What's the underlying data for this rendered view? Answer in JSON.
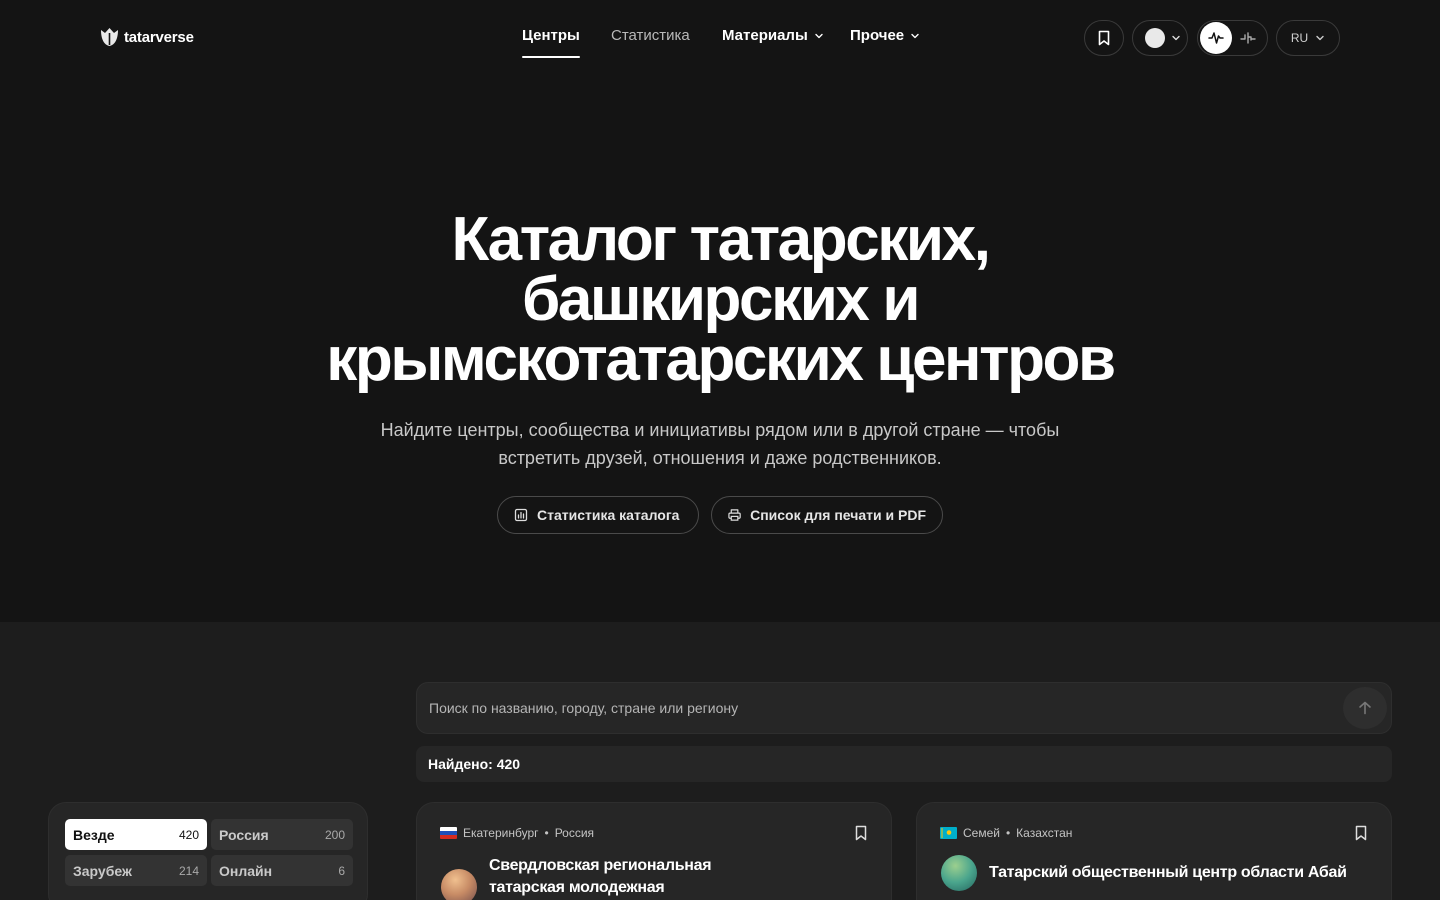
{
  "brand": {
    "name": "tatarverse"
  },
  "nav": {
    "items": [
      {
        "label": "Центры",
        "active": true,
        "dropdown": false
      },
      {
        "label": "Статистика",
        "active": false,
        "dropdown": false
      },
      {
        "label": "Материалы",
        "active": false,
        "dropdown": true
      },
      {
        "label": "Прочее",
        "active": false,
        "dropdown": true
      }
    ]
  },
  "header_controls": {
    "bookmark_icon": "bookmark-icon",
    "theme_icon": "theme-dot-icon",
    "motion_on_icon": "waveform-icon",
    "motion_off_icon": "waveform-off-icon",
    "language": "RU"
  },
  "hero": {
    "title_line1": "Каталог татарских,",
    "title_line2": "башкирских и",
    "title_line3": "крымскотатарских центров",
    "subtitle_line1": "Найдите центры, сообщества и инициативы рядом или в другой стране — чтобы",
    "subtitle_line2": "встретить друзей, отношения и даже родственников.",
    "stats_button": "Статистика каталога",
    "print_button": "Список для печати и PDF"
  },
  "search": {
    "placeholder": "Поиск по названию, городу, стране или региону",
    "found_text": "Найдено: 420"
  },
  "filters": [
    {
      "label": "Везде",
      "count": "420",
      "active": true
    },
    {
      "label": "Россия",
      "count": "200",
      "active": false
    },
    {
      "label": "Зарубеж",
      "count": "214",
      "active": false
    },
    {
      "label": "Онлайн",
      "count": "6",
      "active": false
    }
  ],
  "cards": [
    {
      "city": "Екатеринбург",
      "country": "Россия",
      "flag": "russia-flag",
      "title": "Свердловская региональная татарская молодежная"
    },
    {
      "city": "Семей",
      "country": "Казахстан",
      "flag": "kazakhstan-flag",
      "title": "Татарский общественный центр области Абай"
    }
  ],
  "colors": {
    "background": "#141414",
    "catalog_background": "#1d1d1d",
    "surface": "#262626",
    "text": "#ffffff",
    "muted": "#c8c8c8"
  }
}
